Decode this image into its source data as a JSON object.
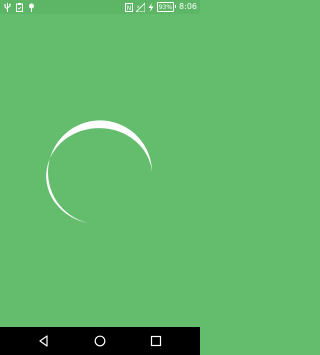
{
  "status_bar": {
    "left_icons": [
      "usb-icon",
      "clipboard-icon",
      "location-icon"
    ],
    "right_icons": [
      "nfc-icon",
      "signal-icon",
      "battery-saver-icon"
    ],
    "battery_text": "93%",
    "time": "8:06"
  },
  "main": {
    "loading_indicator": "spinner-arc",
    "background_color": "#64BC6D",
    "spinner_color": "#FFFFFF"
  },
  "nav_bar": {
    "buttons": [
      "back-icon",
      "home-icon",
      "recents-icon"
    ]
  }
}
